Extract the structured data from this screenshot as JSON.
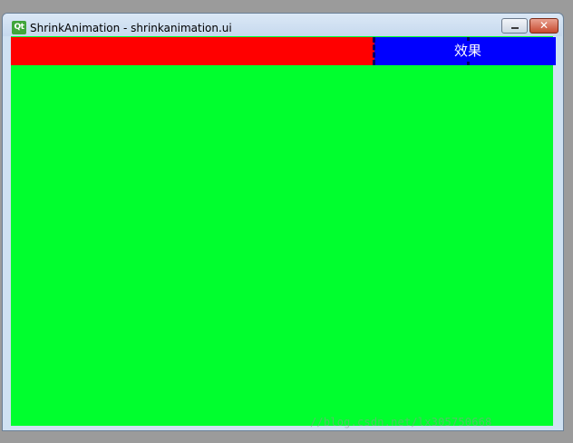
{
  "window": {
    "icon_label": "Qt",
    "title": "ShrinkAnimation - shrinkanimation.ui",
    "minimize_glyph": "–",
    "close_glyph": "✕"
  },
  "content": {
    "effect_button_label": "效果"
  },
  "watermark": {
    "text": "//blog.csdn.net/lx305750668"
  },
  "colors": {
    "client_background": "#00ff2e",
    "red_bar": "#ff0000",
    "effect_button": "#0000ff"
  }
}
